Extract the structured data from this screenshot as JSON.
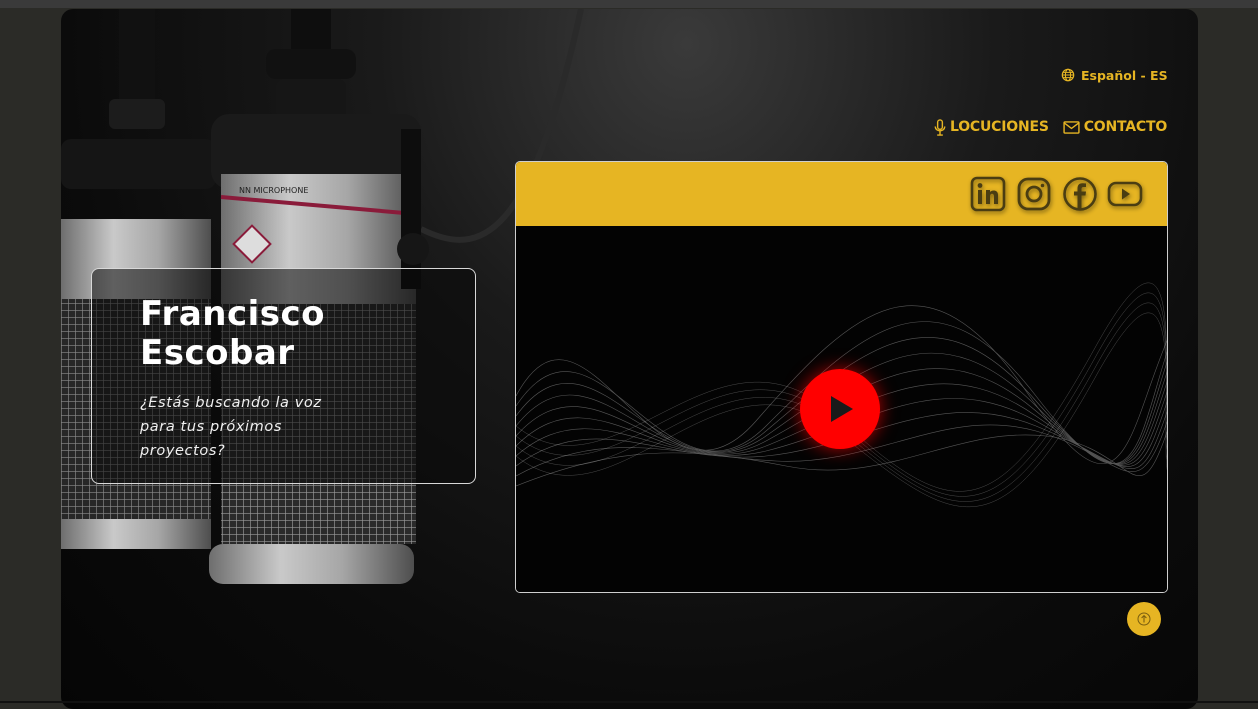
{
  "header": {
    "language_label": "Español - ES",
    "nav": [
      {
        "label": "LOCUCIONES",
        "icon": "microphone-icon"
      },
      {
        "label": "CONTACTO",
        "icon": "envelope-icon"
      }
    ]
  },
  "hero": {
    "name": "Francisco Escobar",
    "tagline": "¿Estás buscando la voz para tus próximos proyectos?"
  },
  "video": {
    "social_icons": [
      "linkedin-icon",
      "instagram-icon",
      "facebook-icon",
      "youtube-icon"
    ],
    "play_icon": "play-icon"
  },
  "background": {
    "microphone_label": "NN MICROPHONE"
  },
  "colors": {
    "accent": "#e6b523",
    "play": "#ff0000",
    "page_bg": "#2b2b27",
    "panel_bg": "#0b0b0b"
  }
}
